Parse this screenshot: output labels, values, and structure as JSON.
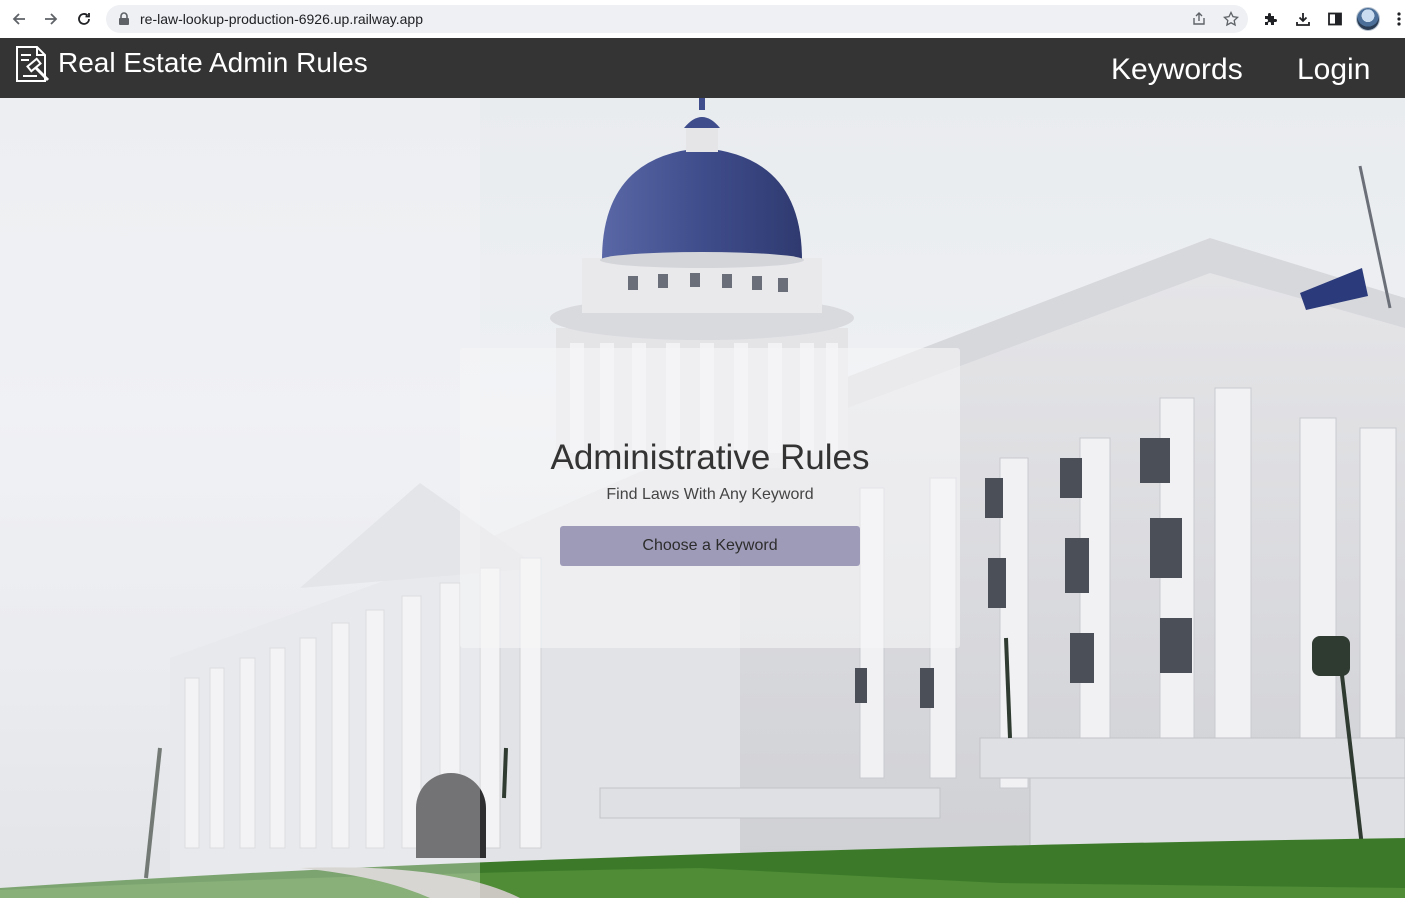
{
  "browser": {
    "url": "re-law-lookup-production-6926.up.railway.app"
  },
  "navbar": {
    "title": "Real Estate Admin Rules",
    "links": [
      "Keywords",
      "Login"
    ]
  },
  "hero": {
    "title": "Administrative Rules",
    "subtitle": "Find Laws With Any Keyword",
    "button_label": "Choose a Keyword"
  },
  "colors": {
    "navbar_bg": "#343434",
    "button_bg": "#9e9bb8",
    "dome_blue": "#3f4d8c"
  }
}
